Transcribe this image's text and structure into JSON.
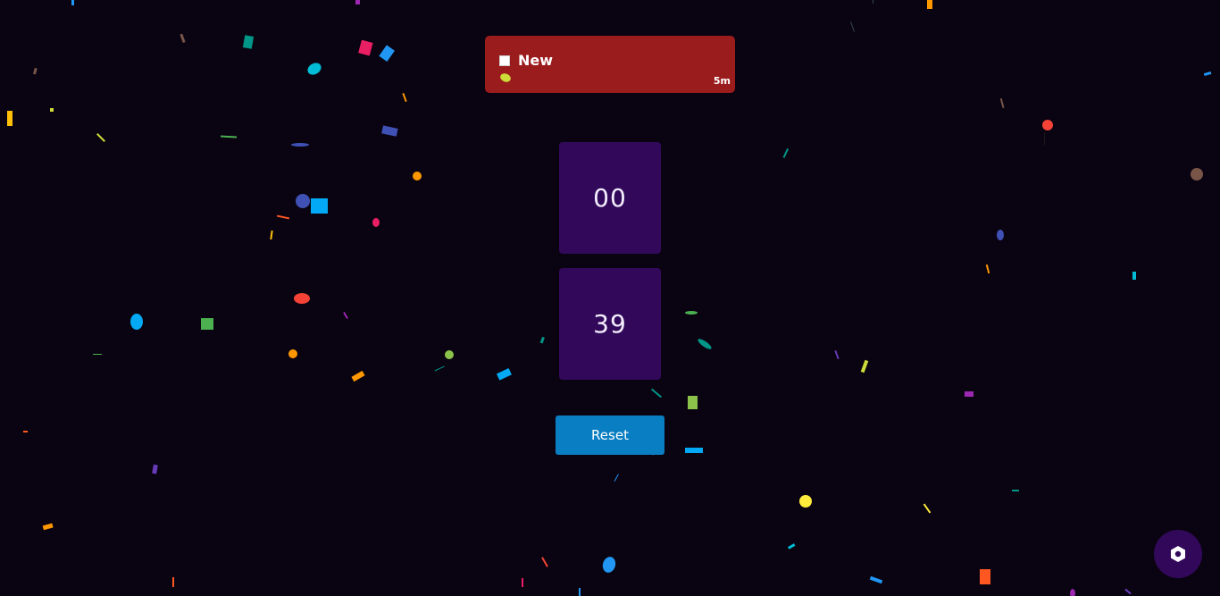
{
  "notification": {
    "title": "New",
    "time": "5m"
  },
  "timer": {
    "minutes": "00",
    "seconds": "39"
  },
  "controls": {
    "reset_label": "Reset"
  },
  "fab": {
    "icon": "hexagon-settings-icon"
  },
  "colors": {
    "background": "#0a0312",
    "notification_bg": "#9b1c1c",
    "timer_box_bg": "#32095a",
    "reset_button_bg": "#0a7ec2",
    "fab_bg": "#32095a"
  }
}
